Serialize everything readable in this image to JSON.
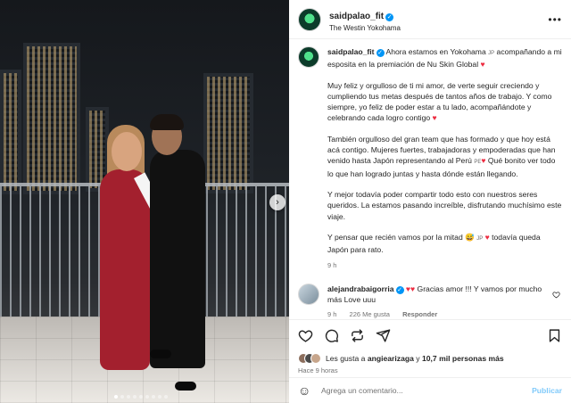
{
  "post": {
    "username": "saidpalao_fit",
    "location": "The Westin Yokohama"
  },
  "caption": {
    "username": "saidpalao_fit",
    "p1_a": "Ahora estamos en Yokohama",
    "p1_flag": "JP",
    "p1_b": "acompañando a mi esposita en la premiación de Nu Skin Global",
    "p2": "Muy feliz y orgulloso de ti mi amor, de verte seguir creciendo y cumpliendo tus metas después de tantos años de trabajo. Y como siempre, yo feliz de poder estar a tu lado, acompañándote y celebrando cada logro contigo",
    "p3_a": "También orgulloso del gran team que has formado y que hoy está acá contigo. Mujeres fuertes, trabajadoras y empoderadas que han venido hasta Japón representando al Perú",
    "p3_flag": "PE",
    "p3_b": "Qué bonito ver todo lo que han logrado juntas y hasta dónde están llegando.",
    "p4": "Y mejor todavía poder compartir todo esto con nuestros seres queridos. La estamos pasando increíble, disfrutando muchísimo este viaje.",
    "p5_a": "Y pensar que recién vamos por la mitad",
    "p5_emoji": "😅",
    "p5_flag": "JP",
    "p5_b": "todavía queda Japón para rato.",
    "time": "9 h"
  },
  "comment": {
    "username": "alejandrabaigorria",
    "text_a": "Gracias amor !!! Y vamos por mucho más Love uuu",
    "time": "9 h",
    "likes": "226 Me gusta",
    "reply": "Responder"
  },
  "likes": {
    "prefix": "Les gusta a",
    "user": "angiearizaga",
    "middle": "y",
    "count": "10,7 mil personas más"
  },
  "posted_ago": "Hace 9 horas",
  "composer": {
    "placeholder": "Agrega un comentario...",
    "publish": "Publicar",
    "emoji": "☺"
  },
  "photo": {
    "slide_count": 9,
    "active_slide": 0,
    "next_arrow": "›"
  },
  "colors": {
    "accent": "#0095f6",
    "heart": "#ed2b40",
    "text": "#262626",
    "muted": "#737373"
  }
}
